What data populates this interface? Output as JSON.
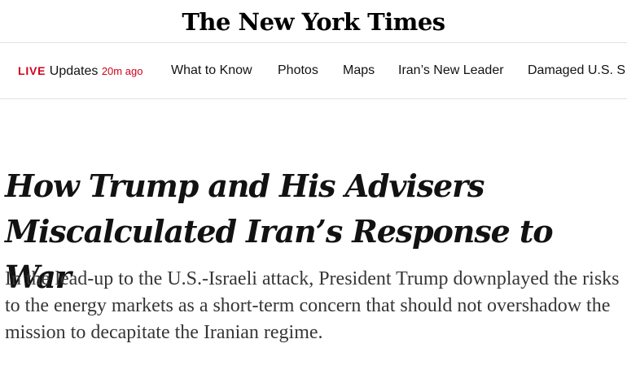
{
  "masthead": {
    "logo_text": "The New York Times"
  },
  "nav": {
    "live_label": "LIVE",
    "updates_label": "Updates",
    "updated_ago": "20m ago",
    "items": [
      "What to Know",
      "Photos",
      "Maps",
      "Iran’s New Leader",
      "Damaged U.S. S"
    ]
  },
  "article": {
    "headline_line1": "How Trump and His Advisers",
    "headline_line2": "Miscalculated Iran’s Response to War",
    "summary": "In the lead-up to the U.S.-Israeli attack, President Trump downplayed the risks to the energy markets as a short-term concern that should not overshadow the mission to decapitate the Iranian regime."
  },
  "colors": {
    "live_red": "#d0021b",
    "text": "#121212",
    "summary_text": "#363636",
    "divider": "#e2e2e2"
  }
}
